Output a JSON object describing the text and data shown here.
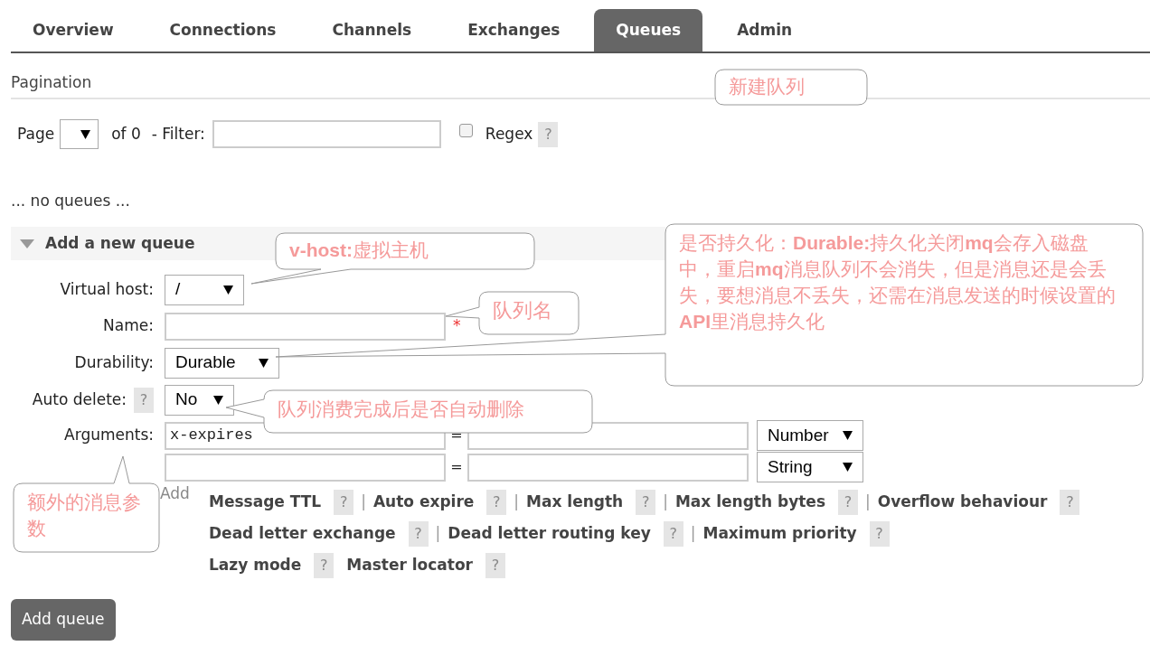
{
  "tabs": [
    {
      "label": "Overview",
      "selected": false
    },
    {
      "label": "Connections",
      "selected": false
    },
    {
      "label": "Channels",
      "selected": false
    },
    {
      "label": "Exchanges",
      "selected": false
    },
    {
      "label": "Queues",
      "selected": true
    },
    {
      "label": "Admin",
      "selected": false
    }
  ],
  "pagination": {
    "title": "Pagination",
    "page_label": "Page",
    "of_label": "of 0",
    "filter_label": "- Filter:",
    "regex": {
      "label": "Regex",
      "checked": false,
      "help": "?"
    }
  },
  "empty_message": "... no queues ...",
  "add_queue": {
    "title": "Add a new queue",
    "expanded": true,
    "fields": [
      {
        "kind": "select",
        "label": "Virtual host:",
        "value": "/"
      },
      {
        "kind": "text",
        "label": "Name:",
        "required_mark": "*"
      },
      {
        "kind": "select",
        "label": "Durability:",
        "value": "Durable"
      },
      {
        "kind": "select",
        "label": "Auto delete:",
        "help": "?",
        "value": "No"
      },
      {
        "kind": "arguments",
        "label": "Arguments:",
        "rows": [
          {
            "key": "x-expires",
            "equals": "=",
            "type": "Number"
          },
          {
            "equals": "=",
            "type": "String"
          }
        ]
      }
    ],
    "add_label": "Add",
    "argument_link_rows": [
      {
        "links": [
          {
            "label": "Message TTL",
            "help": "?",
            "separator": "|"
          },
          {
            "label": "Auto expire",
            "help": "?",
            "separator": "|"
          },
          {
            "label": "Max length",
            "help": "?",
            "separator": "|"
          },
          {
            "label": "Max length bytes",
            "help": "?",
            "separator": "|"
          },
          {
            "label": "Overflow behaviour",
            "help": "?"
          }
        ]
      },
      {
        "links": [
          {
            "label": "Dead letter exchange",
            "help": "?",
            "separator": "|"
          },
          {
            "label": "Dead letter routing key",
            "help": "?",
            "separator": "|"
          },
          {
            "label": "Maximum priority",
            "help": "?"
          }
        ]
      },
      {
        "links": [
          {
            "label": "Lazy mode",
            "help": "?"
          },
          {
            "label": "Master locator",
            "help": "?"
          }
        ]
      }
    ],
    "submit": "Add queue"
  },
  "annotations": [
    {
      "text": "新建队列"
    },
    {
      "text": "**v-host:**虚拟主机"
    },
    {
      "text": "队列名"
    },
    {
      "text": "是否持久化：**Durable:**持久化关闭**mq**会存入磁盘中，重启**mq**消息队列不会消失，但是消息还是会丢失，要想消息不丢失，还需在消息发送的时候设置的**API**里消息持久化"
    },
    {
      "text": "队列消费完成后是否自动删除"
    },
    {
      "text": "额外的消息参数"
    }
  ]
}
